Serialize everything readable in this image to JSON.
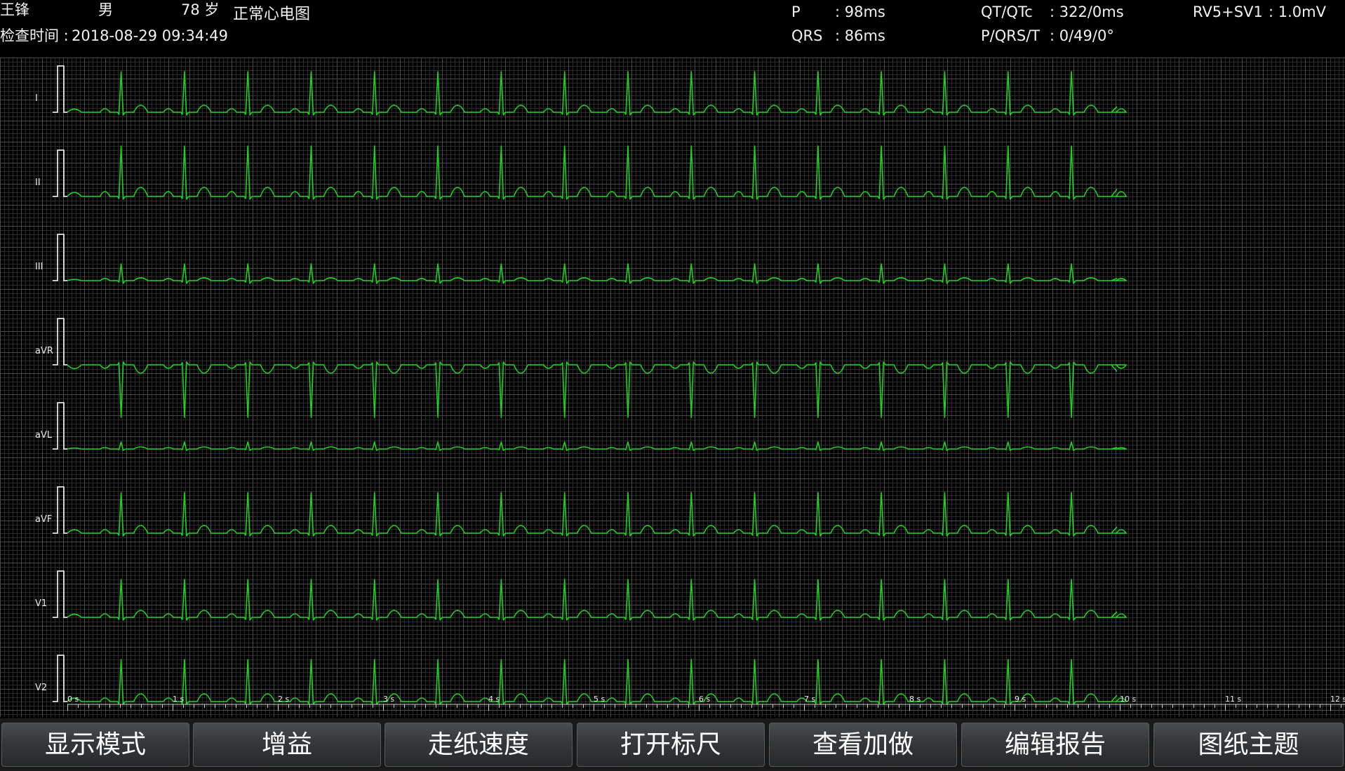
{
  "patient": {
    "name": "王锋",
    "sex": "男",
    "age": "78 岁",
    "exam_time_label": "检查时间 :",
    "exam_time": "2018-08-29 09:34:49"
  },
  "diagnosis": "正常心电图",
  "measurements": {
    "p_label": "P",
    "p_value": ": 98ms",
    "qrs_label": "QRS",
    "qrs_value": ": 86ms",
    "qt_label": "QT/QTc",
    "qt_value": ": 322/0ms",
    "axis_label": "P/QRS/T",
    "axis_value": ": 0/49/0°",
    "rv_label": "RV5+SV1",
    "rv_value": ": 1.0mV"
  },
  "leads": [
    "I",
    "II",
    "III",
    "aVR",
    "aVL",
    "aVF",
    "V1",
    "V2"
  ],
  "time_labels": [
    "0 s",
    "1 s",
    "2 s",
    "3 s",
    "4 s",
    "5 s",
    "6 s",
    "7 s",
    "8 s",
    "9 s",
    "10 s",
    "11 s",
    "12 s"
  ],
  "toolbar": {
    "display_mode": "显示模式",
    "gain": "增益",
    "paper_speed": "走纸速度",
    "open_ruler": "打开标尺",
    "view_extra": "查看加做",
    "edit_report": "编辑报告",
    "paper_theme": "图纸主题"
  },
  "colors": {
    "background": "#000000",
    "grid_minor": "#2b2b2b",
    "grid_major": "#4a4a4a",
    "trace": "#1fd11f",
    "calibration": "#ffffff"
  }
}
